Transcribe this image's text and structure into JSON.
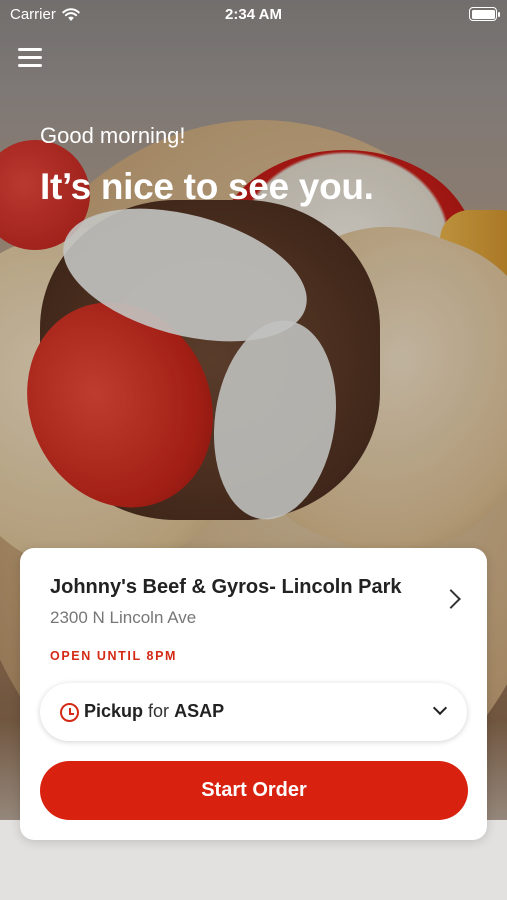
{
  "status_bar": {
    "carrier": "Carrier",
    "time": "2:34 AM"
  },
  "header": {
    "menu_icon": "hamburger-menu-icon"
  },
  "hero": {
    "greeting": "Good morning!",
    "headline": "It’s nice to see you."
  },
  "store": {
    "name": "Johnny's Beef & Gyros- Lincoln Park",
    "address": "2300 N Lincoln Ave",
    "open_status": "OPEN UNTIL 8PM"
  },
  "order_mode": {
    "mode": "Pickup",
    "connector": "for",
    "time": "ASAP"
  },
  "actions": {
    "start_order": "Start Order"
  },
  "colors": {
    "accent": "#d8210f",
    "status_text": "#d42a15"
  }
}
